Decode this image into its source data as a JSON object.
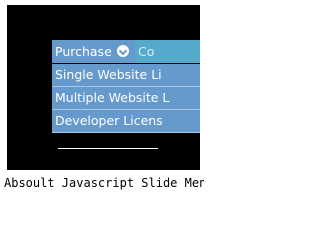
{
  "menu": {
    "top_items": [
      {
        "label": "Purchase",
        "icon": "chevron-down-icon"
      },
      {
        "label": "Co"
      }
    ],
    "submenu": [
      {
        "label": "Single Website Li"
      },
      {
        "label": "Multiple Website L"
      },
      {
        "label": "Developer Licens"
      }
    ]
  },
  "caption": "Absoult Javascript Slide Menu ...",
  "colors": {
    "stage": "#000000",
    "menu": "#6699cc",
    "menu_second": "#55aacc",
    "text": "#ffffff"
  }
}
